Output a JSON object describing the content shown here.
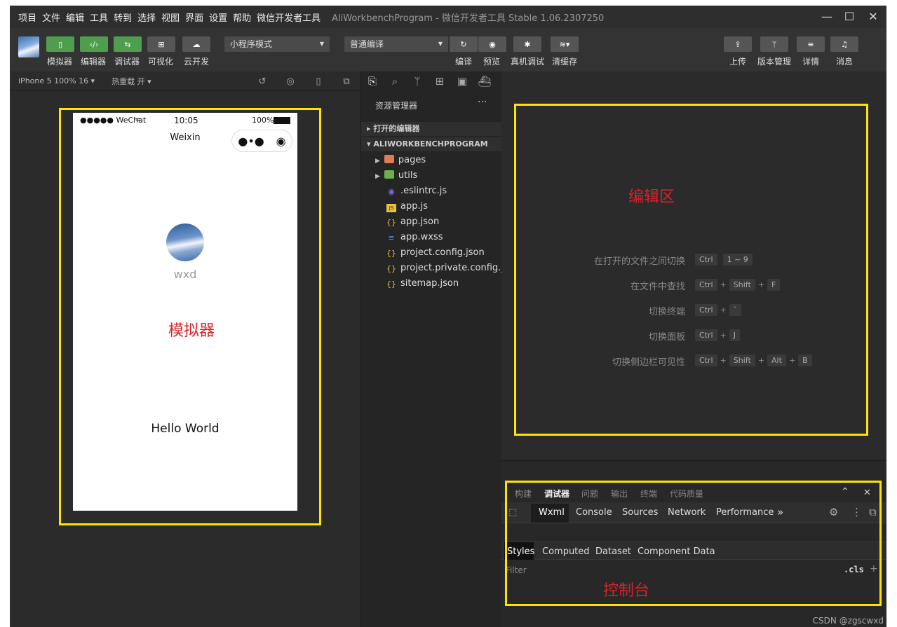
{
  "menubar": {
    "items": [
      "项目",
      "文件",
      "编辑",
      "工具",
      "转到",
      "选择",
      "视图",
      "界面",
      "设置",
      "帮助",
      "微信开发者工具"
    ],
    "title": "AliWorkbenchProgram - 微信开发者工具 Stable 1.06.2307250"
  },
  "toolbar": {
    "simulator": "模拟器",
    "editor": "编辑器",
    "debugger": "调试器",
    "visual": "可视化",
    "cloud": "云开发",
    "mode_select": "小程序模式",
    "compile_select": "普通编译",
    "compile": "编译",
    "preview": "预览",
    "real_debug": "真机调试",
    "clear_cache": "清缓存",
    "upload": "上传",
    "version": "版本管理",
    "details": "详情",
    "messages": "消息"
  },
  "simbar": {
    "device": "iPhone 5 100% 16 ▾",
    "hotreload": "热重载 开 ▾"
  },
  "phone": {
    "signal": "●●●●● WeChat",
    "time": "10:05",
    "battery": "100%",
    "nav_title": "Weixin",
    "nickname": "wxd",
    "hello": "Hello World"
  },
  "labels": {
    "simulator": "模拟器",
    "editor": "编辑区",
    "console": "控制台"
  },
  "explorer": {
    "title": "资源管理器",
    "more": "···",
    "open_editors": "打开的编辑器",
    "project": "ALIWORKBENCHPROGRAM",
    "files": [
      ".eslintrc.js",
      "app.js",
      "app.json",
      "app.wxss",
      "project.config.json",
      "project.private.config.js...",
      "sitemap.json"
    ],
    "folders": [
      "pages",
      "utils"
    ]
  },
  "shortcuts": [
    {
      "label": "在打开的文件之间切换",
      "keys": [
        "Ctrl",
        "1 ~ 9"
      ]
    },
    {
      "label": "在文件中查找",
      "keys": [
        "Ctrl",
        "Shift",
        "F"
      ]
    },
    {
      "label": "切换终端",
      "keys": [
        "Ctrl",
        "`"
      ]
    },
    {
      "label": "切换面板",
      "keys": [
        "Ctrl",
        "J"
      ]
    },
    {
      "label": "切换侧边栏可见性",
      "keys": [
        "Ctrl",
        "Shift",
        "Alt",
        "B"
      ]
    }
  ],
  "console": {
    "tabs": [
      "构建",
      "调试器",
      "问题",
      "输出",
      "终端",
      "代码质量"
    ],
    "devtools_tabs": [
      "Wxml",
      "Console",
      "Sources",
      "Network",
      "Performance",
      "»"
    ],
    "style_tabs": [
      "Styles",
      "Computed",
      "Dataset",
      "Component Data"
    ],
    "filter": "Filter",
    "cls": ".cls"
  },
  "watermark": "CSDN @zgscwxd"
}
